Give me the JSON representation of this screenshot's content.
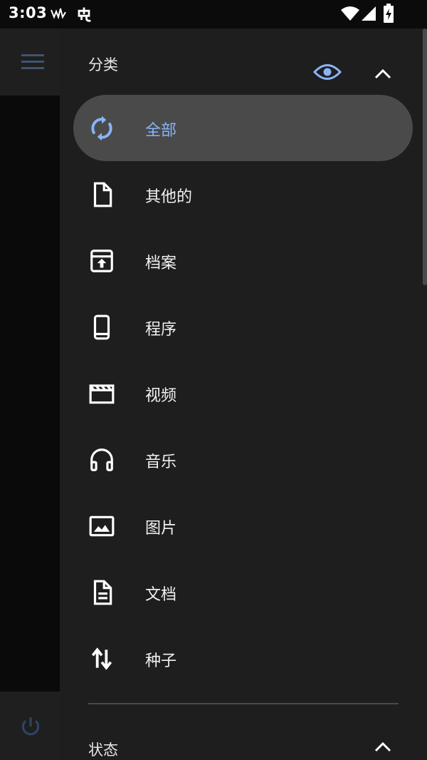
{
  "status_bar": {
    "time": "3:03",
    "icons": [
      "activity-icon",
      "bug-icon",
      "wifi-icon",
      "signal-icon",
      "battery-charging-icon"
    ]
  },
  "background_app": {
    "icons": [
      "hamburger-menu-icon",
      "power-icon"
    ]
  },
  "drawer": {
    "categories_section": {
      "title": "分类",
      "icons": [
        "eye-icon",
        "chevron-up-icon"
      ],
      "items": [
        {
          "label": "全部",
          "icon": "refresh-icon",
          "active": true
        },
        {
          "label": "其他的",
          "icon": "file-icon",
          "active": false
        },
        {
          "label": "档案",
          "icon": "archive-icon",
          "active": false
        },
        {
          "label": "程序",
          "icon": "phone-icon",
          "active": false
        },
        {
          "label": "视频",
          "icon": "video-clapper-icon",
          "active": false
        },
        {
          "label": "音乐",
          "icon": "headphones-icon",
          "active": false
        },
        {
          "label": "图片",
          "icon": "image-icon",
          "active": false
        },
        {
          "label": "文档",
          "icon": "document-icon",
          "active": false
        },
        {
          "label": "种子",
          "icon": "swap-vertical-icon",
          "active": false
        }
      ]
    },
    "status_section": {
      "title": "状态",
      "icons": [
        "chevron-up-icon"
      ]
    }
  },
  "colors": {
    "accent": "#8ab4f8",
    "drawer_bg": "#1e1e1e",
    "active_item_bg": "#4a4a4a",
    "icon_white": "#ffffff"
  }
}
